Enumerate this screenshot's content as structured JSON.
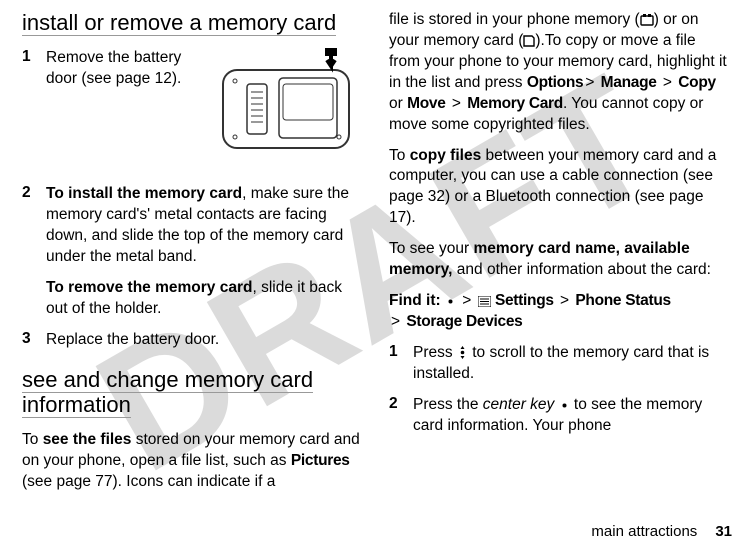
{
  "watermark": "DRAFT",
  "left": {
    "heading1": "install or remove a memory card",
    "steps": [
      {
        "num": "1",
        "body_pre": "Remove the battery door (see page 12)."
      },
      {
        "num": "2",
        "bold_lead": "To install the memory card",
        "body_after_lead": ", make sure the memory card's' metal contacts are facing down, and slide the top of the memory card under the metal band."
      },
      {
        "num": "3",
        "body_pre": "Replace the battery door."
      }
    ],
    "step2_extra_bold": "To remove the memory card",
    "step2_extra_rest": ", slide it back out of the holder.",
    "heading2": "see and change memory card information",
    "para2_pre": "To ",
    "para2_bold": "see the files",
    "para2_mid": " stored on your memory card and on your phone, open a file list, such as ",
    "para2_cond": "Pictures",
    "para2_post": " (see page 77). Icons can indicate if a "
  },
  "right": {
    "para1_pre": "file is stored in your phone memory (",
    "para1_mid1": ") or on your memory card (",
    "para1_mid2": ").To copy or move a file from your phone to your memory card, highlight it in the list and press ",
    "opt": "Options",
    "manage": "Manage",
    "copy": "Copy",
    "or": " or ",
    "move": "Move",
    "memcard": "Memory Card",
    "para1_post": ". You cannot copy or move some copyrighted files.",
    "para2_pre": "To ",
    "para2_bold": "copy files",
    "para2_post": " between your memory card and a computer, you can use a cable connection (see page 32) or a Bluetooth connection (see page 17).",
    "para3_pre": "To see your ",
    "para3_bold": "memory card name, available memory,",
    "para3_post": " and other information about the card:",
    "findit": "Find it: ",
    "settings": "Settings",
    "phonestatus": "Phone Status",
    "storagedev": "Storage Devices",
    "steps": [
      {
        "num": "1",
        "a": "Press ",
        "b": " to scroll to the memory card that is installed."
      },
      {
        "num": "2",
        "a": "Press the ",
        "ital": "center key",
        "b": " to see the memory card information. Your phone "
      }
    ]
  },
  "footer": {
    "section": "main attractions",
    "page": "31"
  }
}
